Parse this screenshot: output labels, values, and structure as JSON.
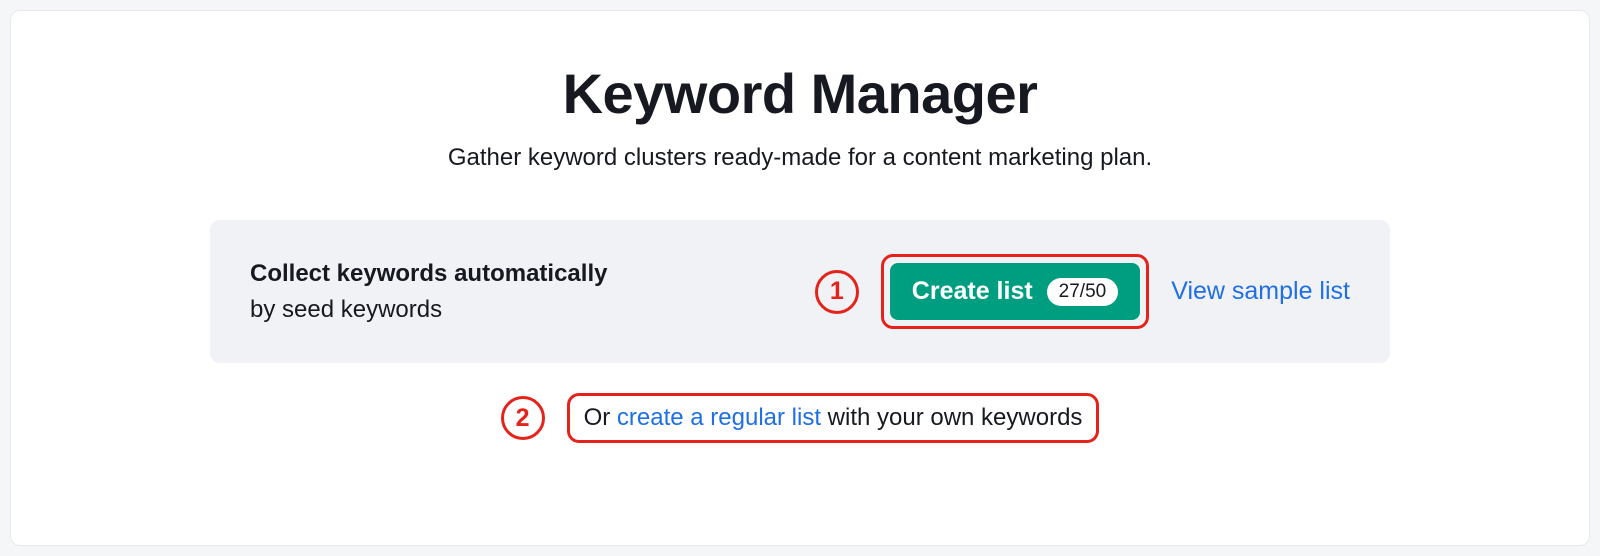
{
  "header": {
    "title": "Keyword Manager",
    "subtitle": "Gather keyword clusters ready-made for a content marketing plan."
  },
  "option_box": {
    "line1": "Collect keywords automatically",
    "line2": "by seed keywords"
  },
  "create_button": {
    "label": "Create list",
    "count": "27/50"
  },
  "sample_link": "View sample list",
  "annotations": {
    "num1": "1",
    "num2": "2"
  },
  "alt_row": {
    "prefix": "Or ",
    "link": "create a regular list",
    "suffix": " with your own keywords"
  }
}
